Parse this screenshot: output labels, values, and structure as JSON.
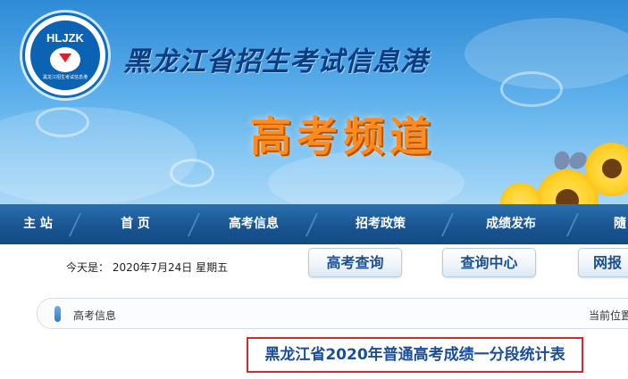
{
  "banner": {
    "logo_text": "HLJZK",
    "logo_subtext": "黑龙江招生考试信息港",
    "site_title": "黑龙江省招生考试信息港",
    "channel_title": "高考频道"
  },
  "nav": {
    "items": [
      {
        "label": "主 站"
      },
      {
        "label": "首 页"
      },
      {
        "label": "高考信息"
      },
      {
        "label": "招考政策"
      },
      {
        "label": "成绩发布"
      },
      {
        "label": "隨"
      }
    ]
  },
  "toolbar": {
    "date_text": "今天是： 2020年7月24日 星期五",
    "buttons": [
      {
        "label": "高考查询"
      },
      {
        "label": "查询中心"
      },
      {
        "label": "网报"
      }
    ]
  },
  "location": {
    "label": "高考信息",
    "right_text": "当前位置"
  },
  "article": {
    "title": "黑龙江省2020年普通高考成绩一分段统计表"
  },
  "colors": {
    "nav_bg": "#1a5592",
    "title_border": "#d8282f",
    "title_text": "#1a4d9c",
    "channel_orange": "#ff8a1e"
  }
}
